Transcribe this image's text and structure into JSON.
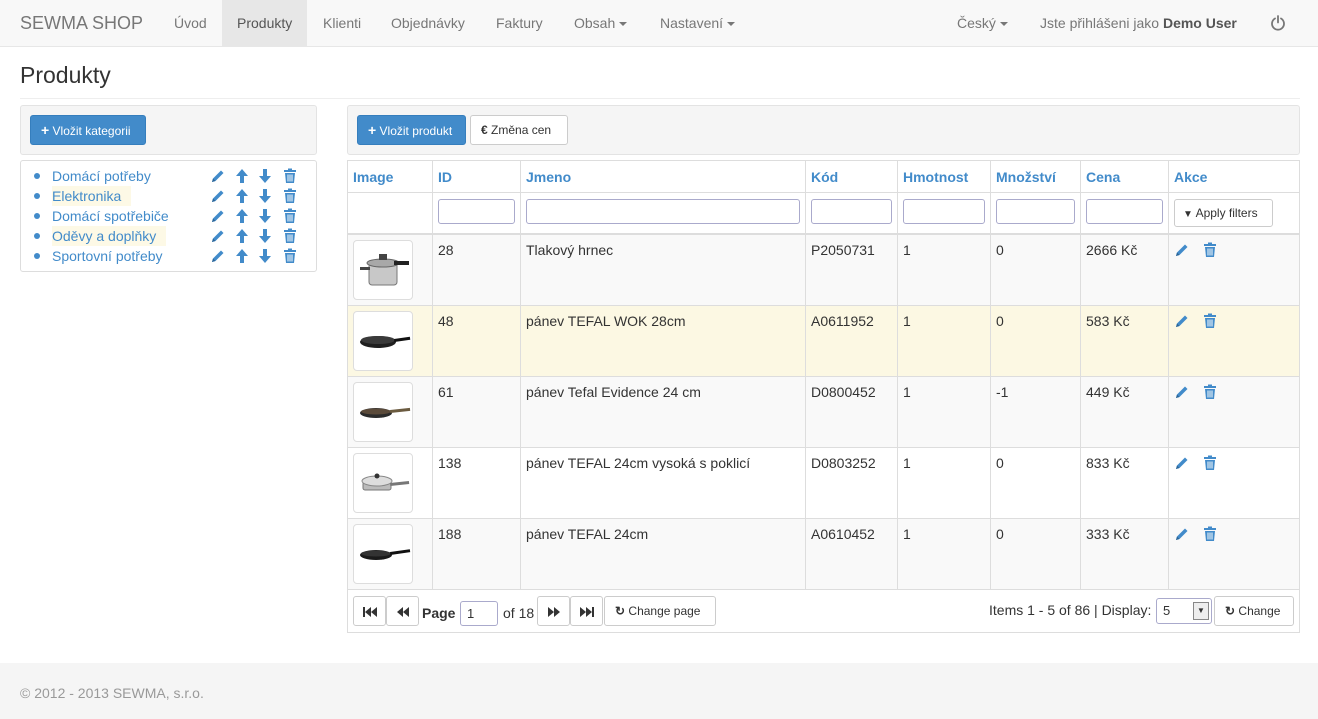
{
  "navbar": {
    "brand": "SEWMA SHOP",
    "items": [
      {
        "label": "Úvod"
      },
      {
        "label": "Produkty"
      },
      {
        "label": "Klienti"
      },
      {
        "label": "Objednávky"
      },
      {
        "label": "Faktury"
      },
      {
        "label": "Obsah"
      },
      {
        "label": "Nastavení"
      }
    ],
    "language": "Český",
    "logged_in_prefix": "Jste přihlášeni jako",
    "user": "Demo User"
  },
  "page_title": "Produkty",
  "categories": {
    "add_button": "Vložit kategorii",
    "items": [
      {
        "label": "Domácí potřeby"
      },
      {
        "label": "Elektronika"
      },
      {
        "label": "Domácí spotřebiče"
      },
      {
        "label": "Oděvy a doplňky"
      },
      {
        "label": "Sportovní potřeby"
      }
    ]
  },
  "toolbar": {
    "add_product": "Vložit produkt",
    "price_change": "Změna cen",
    "euro_symbol": "€"
  },
  "table": {
    "columns": [
      "Image",
      "ID",
      "Jmeno",
      "Kód",
      "Hmotnost",
      "Množství",
      "Cena",
      "Akce"
    ],
    "apply_filters": "Apply filters",
    "rows": [
      {
        "id": "28",
        "name": "Tlakový hrnec",
        "code": "P2050731",
        "weight": "1",
        "qty": "0",
        "price": "2666 Kč"
      },
      {
        "id": "48",
        "name": "pánev TEFAL WOK 28cm",
        "code": "A0611952",
        "weight": "1",
        "qty": "0",
        "price": "583 Kč"
      },
      {
        "id": "61",
        "name": "pánev Tefal Evidence 24 cm",
        "code": "D0800452",
        "weight": "1",
        "qty": "-1",
        "price": "449 Kč"
      },
      {
        "id": "138",
        "name": "pánev TEFAL 24cm vysoká s poklicí",
        "code": "D0803252",
        "weight": "1",
        "qty": "0",
        "price": "833 Kč"
      },
      {
        "id": "188",
        "name": "pánev TEFAL 24cm",
        "code": "A0610452",
        "weight": "1",
        "qty": "0",
        "price": "333 Kč"
      }
    ]
  },
  "pager": {
    "page_label": "Page",
    "page_value": "1",
    "of_label": "of 18",
    "change_page": "Change page",
    "items_text": "Items 1 - 5 of 86 | Display:",
    "display_value": "5",
    "change": "Change"
  },
  "footer": "© 2012 - 2013 SEWMA, s.r.o.",
  "colors": {
    "accent": "#428bca",
    "highlight": "#fcf8e3",
    "navbar": "#f8f8f8"
  }
}
